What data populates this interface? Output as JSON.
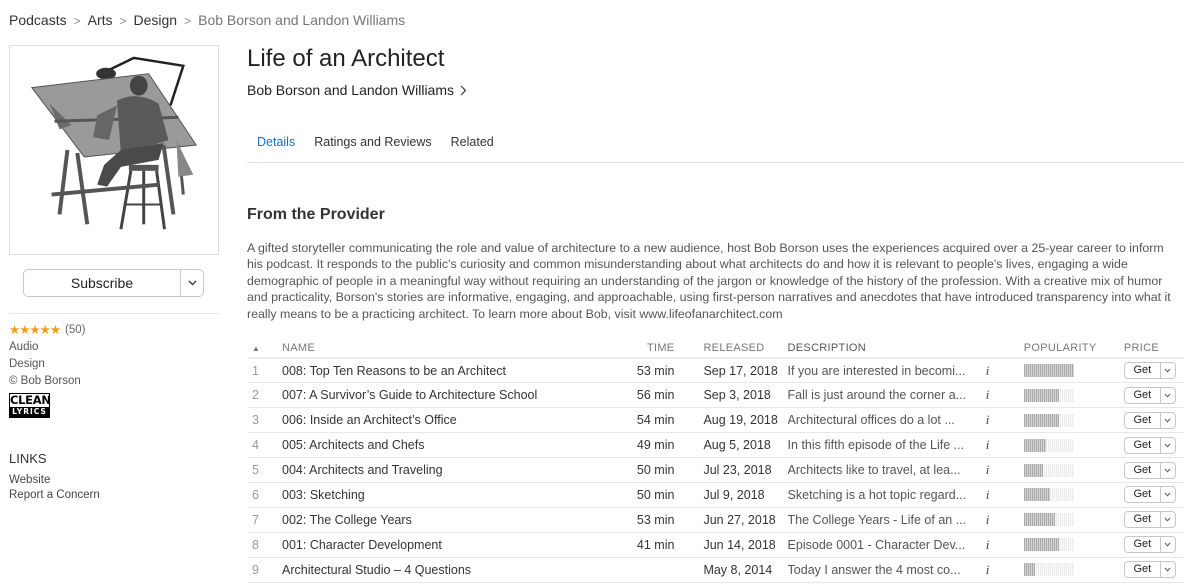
{
  "breadcrumb": [
    "Podcasts",
    "Arts",
    "Design",
    "Bob Borson and Landon Williams"
  ],
  "podcast": {
    "title": "Life of an Architect",
    "artist": "Bob Borson and Landon Williams"
  },
  "sidebar": {
    "subscribe_label": "Subscribe",
    "rating_stars": 5,
    "rating_stars_text": "★★★★★",
    "rating_count": "(50)",
    "type": "Audio",
    "category": "Design",
    "copyright": "© Bob Borson",
    "clean_badge_top": "CLEAN",
    "clean_badge_bottom": "LYRICS",
    "links_title": "LINKS",
    "links": [
      "Website",
      "Report a Concern"
    ]
  },
  "tabs": [
    {
      "label": "Details",
      "active": true
    },
    {
      "label": "Ratings and Reviews",
      "active": false
    },
    {
      "label": "Related",
      "active": false
    }
  ],
  "provider": {
    "title": "From the Provider",
    "description": "A gifted storyteller communicating the role and value of architecture to a new audience, host Bob Borson uses the experiences acquired over a 25-year career to inform his podcast. It responds to the public's curiosity and common misunderstanding about what architects do and how it is relevant to people's lives, engaging a wide demographic of people in a meaningful way without requiring an understanding of the jargon or knowledge of the history of the profession. With a creative mix of humor and practicality, Borson's stories are informative, engaging, and approachable, using first-person narratives and anecdotes that have introduced transparency into what it really means to be a practicing architect. To learn more about Bob, visit www.lifeofanarchitect.com"
  },
  "table": {
    "sort_indicator": "▲",
    "headers": {
      "name": "NAME",
      "time": "TIME",
      "released": "RELEASED",
      "description": "DESCRIPTION",
      "popularity": "POPULARITY",
      "price": "PRICE"
    },
    "info_glyph": "i",
    "get_label": "Get",
    "rows": [
      {
        "index": "1",
        "name": "008: Top Ten Reasons to be an Architect",
        "time": "53 min",
        "released": "Sep 17, 2018",
        "description": "If you are interested in becomi...",
        "popularity": 1.0
      },
      {
        "index": "2",
        "name": "007: A Survivor’s Guide to Architecture School",
        "time": "56 min",
        "released": "Sep 3, 2018",
        "description": "Fall is just around the corner a...",
        "popularity": 0.7
      },
      {
        "index": "3",
        "name": "006: Inside an Architect’s Office",
        "time": "54 min",
        "released": "Aug 19, 2018",
        "description": "Architectural offices do a lot ...",
        "popularity": 0.7
      },
      {
        "index": "4",
        "name": "005: Architects and Chefs",
        "time": "49 min",
        "released": "Aug 5, 2018",
        "description": "In this fifth episode of the Life ...",
        "popularity": 0.45
      },
      {
        "index": "5",
        "name": "004: Architects and Traveling",
        "time": "50 min",
        "released": "Jul 23, 2018",
        "description": "Architects like to travel, at lea...",
        "popularity": 0.38
      },
      {
        "index": "6",
        "name": "003: Sketching",
        "time": "50 min",
        "released": "Jul 9, 2018",
        "description": "Sketching is a hot topic regard...",
        "popularity": 0.53
      },
      {
        "index": "7",
        "name": "002: The College Years",
        "time": "53 min",
        "released": "Jun 27, 2018",
        "description": "The College Years - Life of an ...",
        "popularity": 0.62
      },
      {
        "index": "8",
        "name": "001: Character Development",
        "time": "41 min",
        "released": "Jun 14, 2018",
        "description": "Episode 0001 - Character Dev...",
        "popularity": 0.7
      },
      {
        "index": "9",
        "name": "Architectural Studio – 4 Questions",
        "time": "",
        "released": "May 8, 2014",
        "description": "Today I answer the 4 most co...",
        "popularity": 0.23
      }
    ]
  },
  "colors": {
    "accent": "#1f6fbf",
    "stars": "#f39c12"
  }
}
